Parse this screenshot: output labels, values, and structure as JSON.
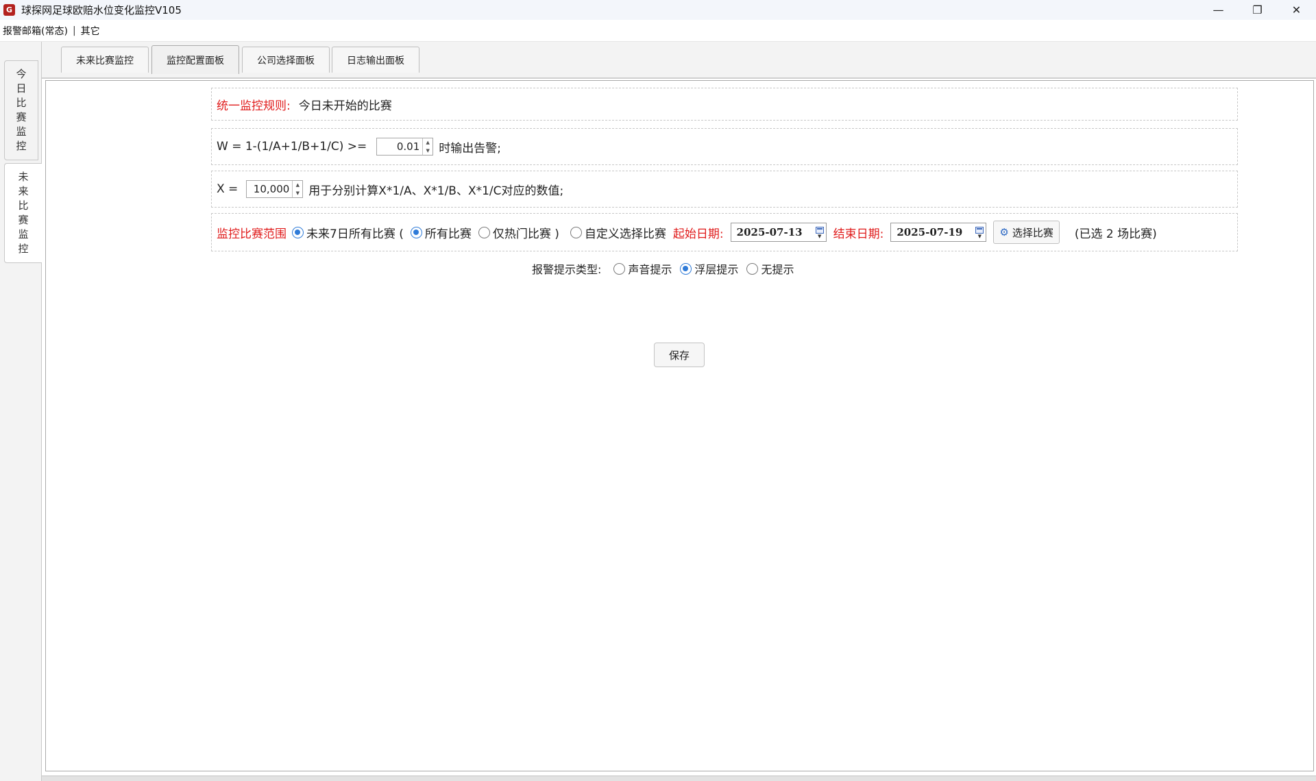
{
  "window": {
    "title": "球探网足球欧赔水位变化监控V105",
    "icon_letter": "G",
    "controls": {
      "minimize": "—",
      "restore": "❐",
      "close": "✕"
    }
  },
  "menu": {
    "items": [
      "报警邮箱(常态)",
      "其它"
    ],
    "separator": "|"
  },
  "side_tabs": [
    {
      "label": "今日比赛监控",
      "chars": [
        "今",
        "日",
        "比",
        "赛",
        "监",
        "控"
      ]
    },
    {
      "label": "未来比赛监控",
      "chars": [
        "未",
        "来",
        "比",
        "赛",
        "监",
        "控"
      ]
    }
  ],
  "top_tabs": [
    "未来比赛监控",
    "监控配置面板",
    "公司选择面板",
    "日志输出面板"
  ],
  "config": {
    "rule_label": "统一监控规则:",
    "rule_value": "今日未开始的比赛",
    "w_formula": "W = 1-(1/A+1/B+1/C) >=",
    "w_value": "0.01",
    "w_suffix": "时输出告警;",
    "x_label": "X =",
    "x_value": "10,000",
    "x_suffix": "用于分别计算X*1/A、X*1/B、X*1/C对应的数值;",
    "range_label": "监控比赛范围",
    "range_option_future7": "未来7日所有比赛 (",
    "range_option_all": "所有比赛",
    "range_option_hot": "仅热门比赛 )",
    "range_option_custom": "自定义选择比赛",
    "start_label": "起始日期:",
    "start_date": "2025-07-13",
    "end_label": "结束日期:",
    "end_date": "2025-07-19",
    "select_button": "选择比赛",
    "selected_count": "(已选 2 场比赛)",
    "alert_label": "报警提示类型:",
    "alert_sound": "声音提示",
    "alert_overlay": "浮层提示",
    "alert_none": "无提示",
    "save_button": "保存"
  }
}
